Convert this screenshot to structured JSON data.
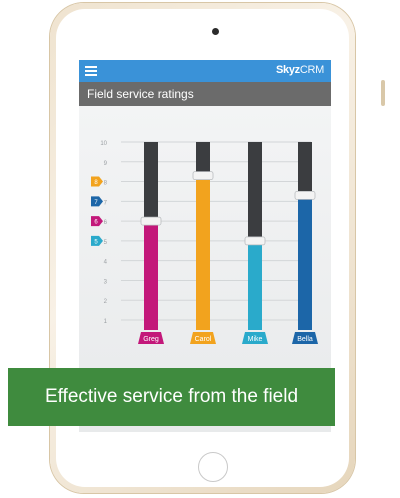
{
  "app": {
    "brand_bold": "Skyz",
    "brand_light": "CRM",
    "page_title": "Field service ratings"
  },
  "banner": {
    "text": "Effective service from the field"
  },
  "colors": {
    "topbar": "#3a92d8",
    "titlebar": "#6b6b6b",
    "banner": "#3f8b3e",
    "greg": "#c3187a",
    "carol": "#f2a31e",
    "mike": "#2aaacb",
    "bella": "#1c66a8"
  },
  "chart_data": {
    "type": "bar",
    "categories": [
      "Greg",
      "Carol",
      "Mike",
      "Bella"
    ],
    "values": [
      6,
      8.3,
      5,
      7.3
    ],
    "ylim": [
      1,
      10
    ],
    "y_ticks": [
      "1",
      "2",
      "3",
      "4",
      "5",
      "6",
      "7",
      "8",
      "9",
      "10"
    ],
    "legend_tags": [
      {
        "label": "8",
        "color": "#f2a31e"
      },
      {
        "label": "7",
        "color": "#1c66a8"
      },
      {
        "label": "6",
        "color": "#c3187a"
      },
      {
        "label": "5",
        "color": "#2aaacb"
      }
    ],
    "grid": true
  }
}
